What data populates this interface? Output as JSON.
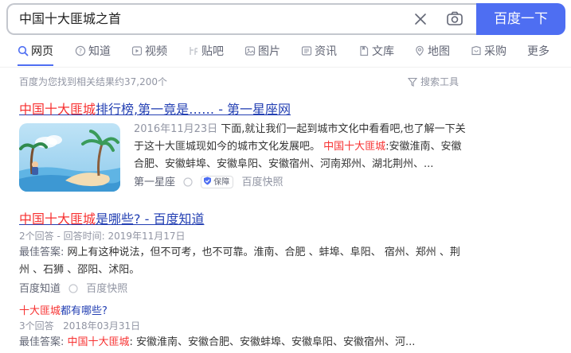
{
  "search": {
    "query": "中国十大匪城之首",
    "button_label": "百度一下"
  },
  "tabs": [
    {
      "label": "网页",
      "icon": "search-icon",
      "active": true
    },
    {
      "label": "知道",
      "icon": "question-icon"
    },
    {
      "label": "视频",
      "icon": "video-icon"
    },
    {
      "label": "贴吧",
      "icon": "tieba-icon"
    },
    {
      "label": "图片",
      "icon": "image-icon"
    },
    {
      "label": "资讯",
      "icon": "news-icon"
    },
    {
      "label": "文库",
      "icon": "document-icon"
    },
    {
      "label": "地图",
      "icon": "map-pin-icon"
    },
    {
      "label": "采购",
      "icon": "shopping-icon"
    },
    {
      "label": "更多"
    }
  ],
  "result_count": "百度为您找到相关结果约37,200个",
  "search_tools": "搜索工具",
  "results": [
    {
      "title_em": "中国十大匪城",
      "title_rest": "排行榜,第一竟是…… - 第一星座网",
      "date": "2016年11月23日",
      "snippet_a": " 下面,就让我们一起到城市文化中看看吧,也了解一下关于这十大匪城现如今的城市文化发展吧。 ",
      "snippet_em": "中国十大匪城",
      "snippet_b": ":安徽淮南、安徽合肥、安徽蚌埠、安徽阜阳、安徽宿州、河南郑州、湖北荆州、...",
      "source": "第一星座",
      "badge": "保障",
      "kuaizhao": "百度快照"
    },
    {
      "title_em": "中国十大匪城",
      "title_rest": "是哪些? - 百度知道",
      "meta": "2个回答 - 回答时间: 2019年11月17日",
      "best_label": "最佳答案: ",
      "best_text": "网上有这种说法，但不可考，也不可靠。淮南、合肥 、蚌埠、阜阳、 宿州、郑州 、荆州 、石狮 、邵阳、沭阳。",
      "source": "百度知道",
      "kuaizhao": "百度快照",
      "sub_q_em": "十大匪城",
      "sub_q_rest": "都有哪些?",
      "sub_meta": "3个回答   2018年03月31日",
      "sub_best_label": "最佳答案: ",
      "sub_best_em": "中国十大匪城",
      "sub_best_text": ": 安徽淮南、安徽合肥、安徽蚌埠、安徽阜阳、安徽宿州、河..."
    }
  ],
  "colors": {
    "brand_blue": "#4e6ef2",
    "link_blue": "#2440b3",
    "highlight_red": "#f73131",
    "muted_gray": "#9195a3"
  }
}
